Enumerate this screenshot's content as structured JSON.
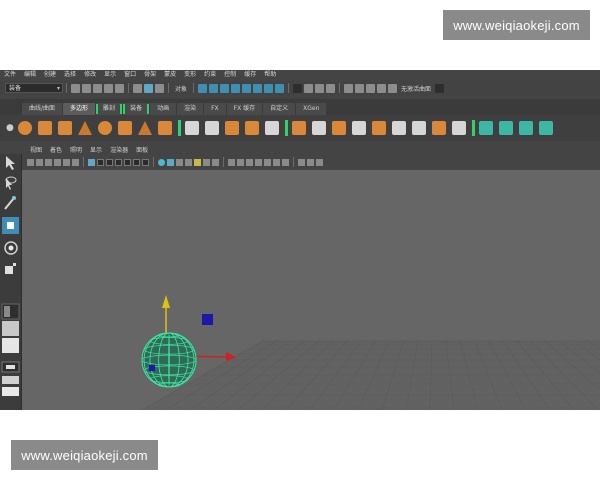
{
  "watermark": {
    "top_text": "www.weiqiaokeji.com",
    "bottom_text": "www.weiqiaokeji.com"
  },
  "menubar": {
    "items": [
      "文件",
      "编辑",
      "创建",
      "选择",
      "修改",
      "显示",
      "窗口",
      "骨架",
      "蒙皮",
      "变形",
      "约束",
      "控制",
      "缓存",
      "帮助"
    ]
  },
  "statusline": {
    "mode_dropdown": "装备",
    "object_label": "对象",
    "live_surface_label": "无激活曲面"
  },
  "shelf_tabs": {
    "items": [
      "曲线/曲面",
      "多边形",
      "雕刻",
      "装备",
      "动画",
      "渲染",
      "FX",
      "FX 缓存",
      "自定义",
      "XGen"
    ],
    "active_index": 1
  },
  "panel_menu": {
    "items": [
      "视图",
      "着色",
      "照明",
      "显示",
      "渲染器",
      "面板"
    ]
  },
  "colors": {
    "ui_background": "#444444",
    "viewport_background": "#666666",
    "selected_wireframe": "#45e0a0",
    "grid_line": "#5a5a5a",
    "axis_x": "#d02020",
    "axis_y": "#e0c010",
    "handle_blue": "#1a1aa8"
  },
  "icons": {
    "shelf": [
      "sphere-icon",
      "cube-icon",
      "cylinder-icon",
      "cone-icon",
      "torus-icon",
      "plane-icon",
      "pyramid-icon",
      "pipe-icon",
      "combine-icon",
      "separate-icon",
      "extrude-icon",
      "bridge-icon",
      "bevel-icon",
      "wedge-icon",
      "append-icon",
      "multicut-icon",
      "split-icon",
      "fill-hole-icon",
      "uv-editor-icon",
      "smooth-icon",
      "reduce-icon",
      "mirror-icon"
    ],
    "toolbox": [
      "select-tool-icon",
      "lasso-tool-icon",
      "paint-select-icon",
      "move-tool-icon",
      "rotate-tool-icon",
      "scale-tool-icon"
    ]
  }
}
